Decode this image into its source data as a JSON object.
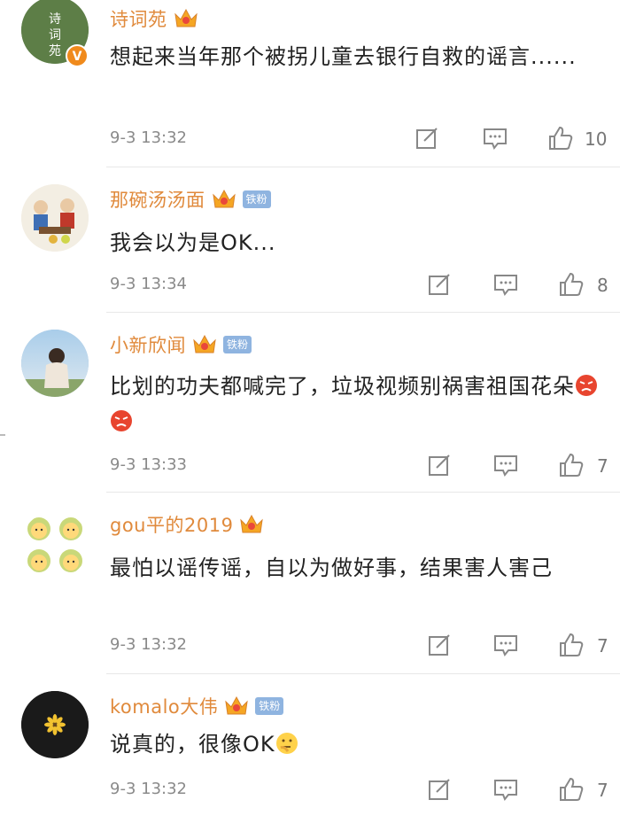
{
  "comments": [
    {
      "username": "诗词苑",
      "badge": "",
      "avatar_text": "诗词苑",
      "content": "想起来当年那个被拐儿童去银行自救的谣言......",
      "time": "9-3 13:32",
      "likes": "10"
    },
    {
      "username": "那碗汤汤面",
      "badge": "铁粉",
      "content": "我会以为是OK...",
      "time": "9-3 13:34",
      "likes": "8"
    },
    {
      "username": "小新欣闻",
      "badge": "铁粉",
      "content": "比划的功夫都喊完了，垃圾视频别祸害祖国花朵",
      "time": "9-3 13:33",
      "likes": "7"
    },
    {
      "username": "gou平的2019",
      "badge": "",
      "content": "最怕以谣传谣，自以为做好事，结果害人害己",
      "time": "9-3 13:32",
      "likes": "7"
    },
    {
      "username": "komalo大伟",
      "badge": "铁粉",
      "content": "说真的，很像OK",
      "time": "9-3 13:32",
      "likes": "7"
    }
  ],
  "colors": {
    "username": "#e08a3c",
    "badge": "#8fb4e0",
    "time": "#8a8a8a"
  }
}
